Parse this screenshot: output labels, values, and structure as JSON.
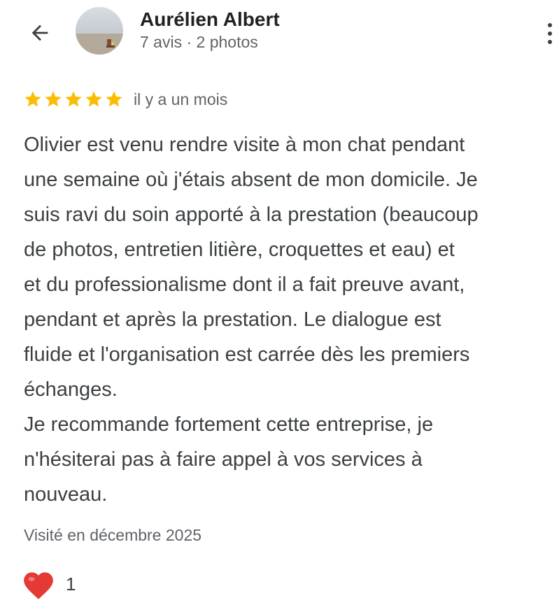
{
  "reviewer": {
    "name": "Aurélien Albert",
    "meta": "7 avis · 2 photos"
  },
  "icons": {
    "back": "arrow-back-icon",
    "more": "more-vert-icon",
    "star": "star-icon",
    "heart": "heart-icon"
  },
  "review": {
    "rating": 5,
    "max_rating": 5,
    "date": "il y a un mois",
    "text": "Olivier est venu rendre visite à mon chat pendant\nune semaine où j'étais absent de mon domicile. Je\nsuis ravi du soin apporté à la prestation (beaucoup\nde photos, entretien litière, croquettes et eau) et\net du professionalisme dont il a fait preuve avant,\npendant et après la prestation. Le dialogue est\nfluide et l'organisation est carrée dès les premiers\néchanges.\nJe recommande fortement cette entreprise, je\nn'hésiterai pas à faire appel à vos services à\nnouveau.",
    "visited": "Visité en décembre 2025"
  },
  "reaction": {
    "count": "1"
  },
  "colors": {
    "star": "#fbbc04",
    "heart": "#e53935",
    "text_primary": "#202124",
    "text_secondary": "#5f6368"
  }
}
